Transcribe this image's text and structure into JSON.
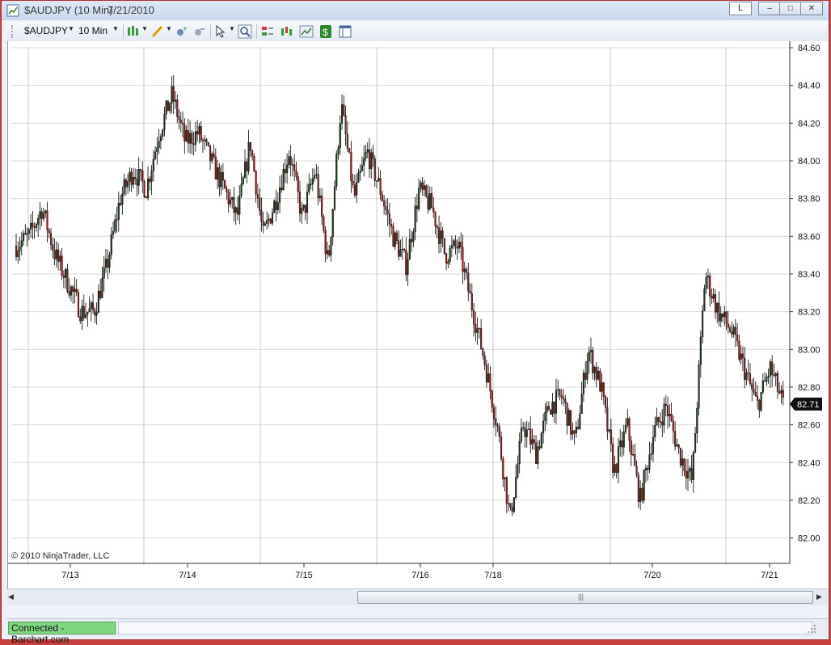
{
  "window": {
    "title_name": "$AUDJPY (10 Min)",
    "title_date": "7/21/2010",
    "badge": "L",
    "controls": [
      "–",
      "□",
      "✕"
    ]
  },
  "toolbar": {
    "instrument": "$AUDJPY",
    "interval": "10 Min"
  },
  "chart": {
    "copyright": "© 2010 NinjaTrader, LLC",
    "last_price_label": "82.71"
  },
  "status": {
    "connection": "Connected - Barchart.com"
  },
  "colors": {
    "up_candle": "#1a3a1a",
    "down_candle": "#8b1a1a",
    "grid": "#d8d8d8",
    "status_ok": "#7fd87f"
  },
  "chart_data": {
    "type": "candlestick",
    "title": "$AUDJPY (10 Min)",
    "ylim": [
      81.9,
      84.6
    ],
    "y_ticks": [
      "84.60",
      "84.40",
      "84.20",
      "84.00",
      "83.80",
      "83.60",
      "83.40",
      "83.20",
      "83.00",
      "82.80",
      "82.60",
      "82.40",
      "82.20",
      "82.00"
    ],
    "x_ticks": [
      "7/13",
      "7/14",
      "7/15",
      "7/16",
      "7/18",
      "7/20",
      "7/21"
    ],
    "last_price": 82.71,
    "x": [
      "7/12",
      "7/13",
      "7/13",
      "7/13",
      "7/13",
      "7/13",
      "7/14",
      "7/14",
      "7/14",
      "7/14",
      "7/14",
      "7/14",
      "7/14",
      "7/14",
      "7/14",
      "7/14",
      "7/15",
      "7/15",
      "7/15",
      "7/15",
      "7/15",
      "7/15",
      "7/15",
      "7/15",
      "7/15",
      "7/16",
      "7/16",
      "7/16",
      "7/16",
      "7/16",
      "7/16",
      "7/18",
      "7/19",
      "7/19",
      "7/19",
      "7/19",
      "7/19",
      "7/19",
      "7/19",
      "7/19",
      "7/19",
      "7/19",
      "7/20",
      "7/20",
      "7/20",
      "7/20",
      "7/20",
      "7/20",
      "7/21",
      "7/21",
      "7/21",
      "7/21",
      "7/21"
    ],
    "series": [
      {
        "values": [
          83.55,
          83.6,
          83.75,
          83.5,
          83.35,
          83.2,
          83.2,
          83.45,
          83.8,
          83.95,
          83.85,
          84.15,
          84.35,
          84.1,
          84.15,
          84.0,
          83.85,
          83.7,
          84.1,
          83.6,
          83.8,
          84.05,
          83.7,
          83.95,
          83.45,
          84.3,
          83.8,
          84.05,
          83.85,
          83.6,
          83.45,
          83.85,
          83.75,
          83.5,
          83.55,
          83.25,
          82.95,
          82.6,
          82.1,
          82.6,
          82.45,
          82.7,
          82.75,
          82.5,
          83.0,
          82.8,
          82.35,
          82.6,
          82.2,
          82.55,
          82.7,
          82.45,
          82.3,
          83.4,
          83.2,
          83.1,
          82.9,
          82.7,
          82.9,
          82.71
        ]
      }
    ]
  }
}
